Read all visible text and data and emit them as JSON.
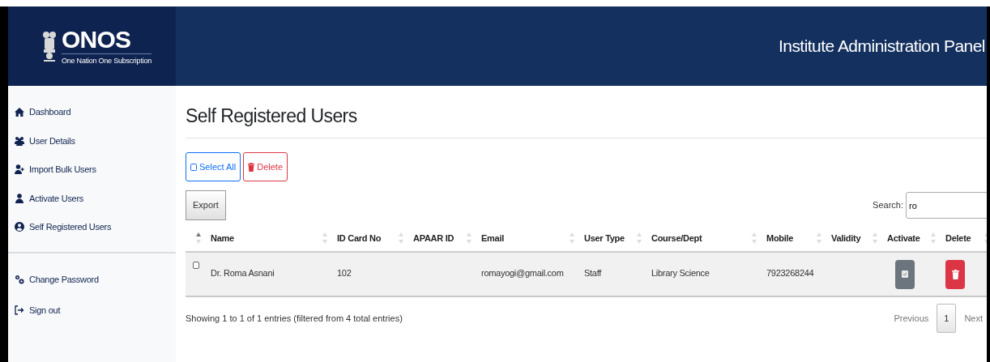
{
  "header": {
    "logo_title": "ONOS",
    "logo_subtitle": "One Nation One Subscription",
    "panel_title": "Institute Administration Panel"
  },
  "sidebar": {
    "main_items": [
      {
        "kind": "home",
        "label": "Dashboard"
      },
      {
        "kind": "users",
        "label": "User Details"
      },
      {
        "kind": "user-plus",
        "label": "Import Bulk Users"
      },
      {
        "kind": "user-tie",
        "label": "Activate Users"
      },
      {
        "kind": "user-circle",
        "label": "Self Registered Users"
      }
    ],
    "account_items": [
      {
        "kind": "cogs",
        "label": "Change Password"
      },
      {
        "kind": "sign-out",
        "label": "Sign out"
      }
    ]
  },
  "page_title": "Self Registered Users",
  "actions": [
    {
      "kind": "select",
      "label": "Select All"
    },
    {
      "kind": "delete",
      "label": "Delete"
    }
  ],
  "export_button": "Export",
  "search": {
    "label": "Search:",
    "value": "ro"
  },
  "table": {
    "columns": [
      {
        "sorted": true
      },
      {
        "label": "Name",
        "sorted": false
      },
      {
        "label": "ID Card No",
        "sorted": false
      },
      {
        "label": "APAAR ID",
        "sorted": false
      },
      {
        "label": "Email",
        "sorted": false
      },
      {
        "label": "User Type",
        "sorted": false
      },
      {
        "label": "Course/Dept",
        "sorted": false
      },
      {
        "label": "Mobile",
        "sorted": false
      },
      {
        "label": "Validity",
        "sorted": false
      },
      {
        "label": "Activate",
        "sorted": false
      },
      {
        "label": "Delete",
        "sorted": false
      }
    ],
    "rows": [
      {
        "checked": false,
        "name": "Dr. Roma Asnani",
        "id_card_no": "102",
        "email": "romayogi@gmail.com",
        "user_type": "Staff",
        "course_dept": "Library Science",
        "mobile": "7923268244"
      }
    ]
  },
  "info": "Showing 1 to 1 of 1 entries (filtered from 4 total entries)",
  "pagination": [
    {
      "label": "Previous",
      "selected": false
    },
    {
      "label": "1",
      "selected": true
    },
    {
      "label": "Next",
      "selected": false
    }
  ]
}
